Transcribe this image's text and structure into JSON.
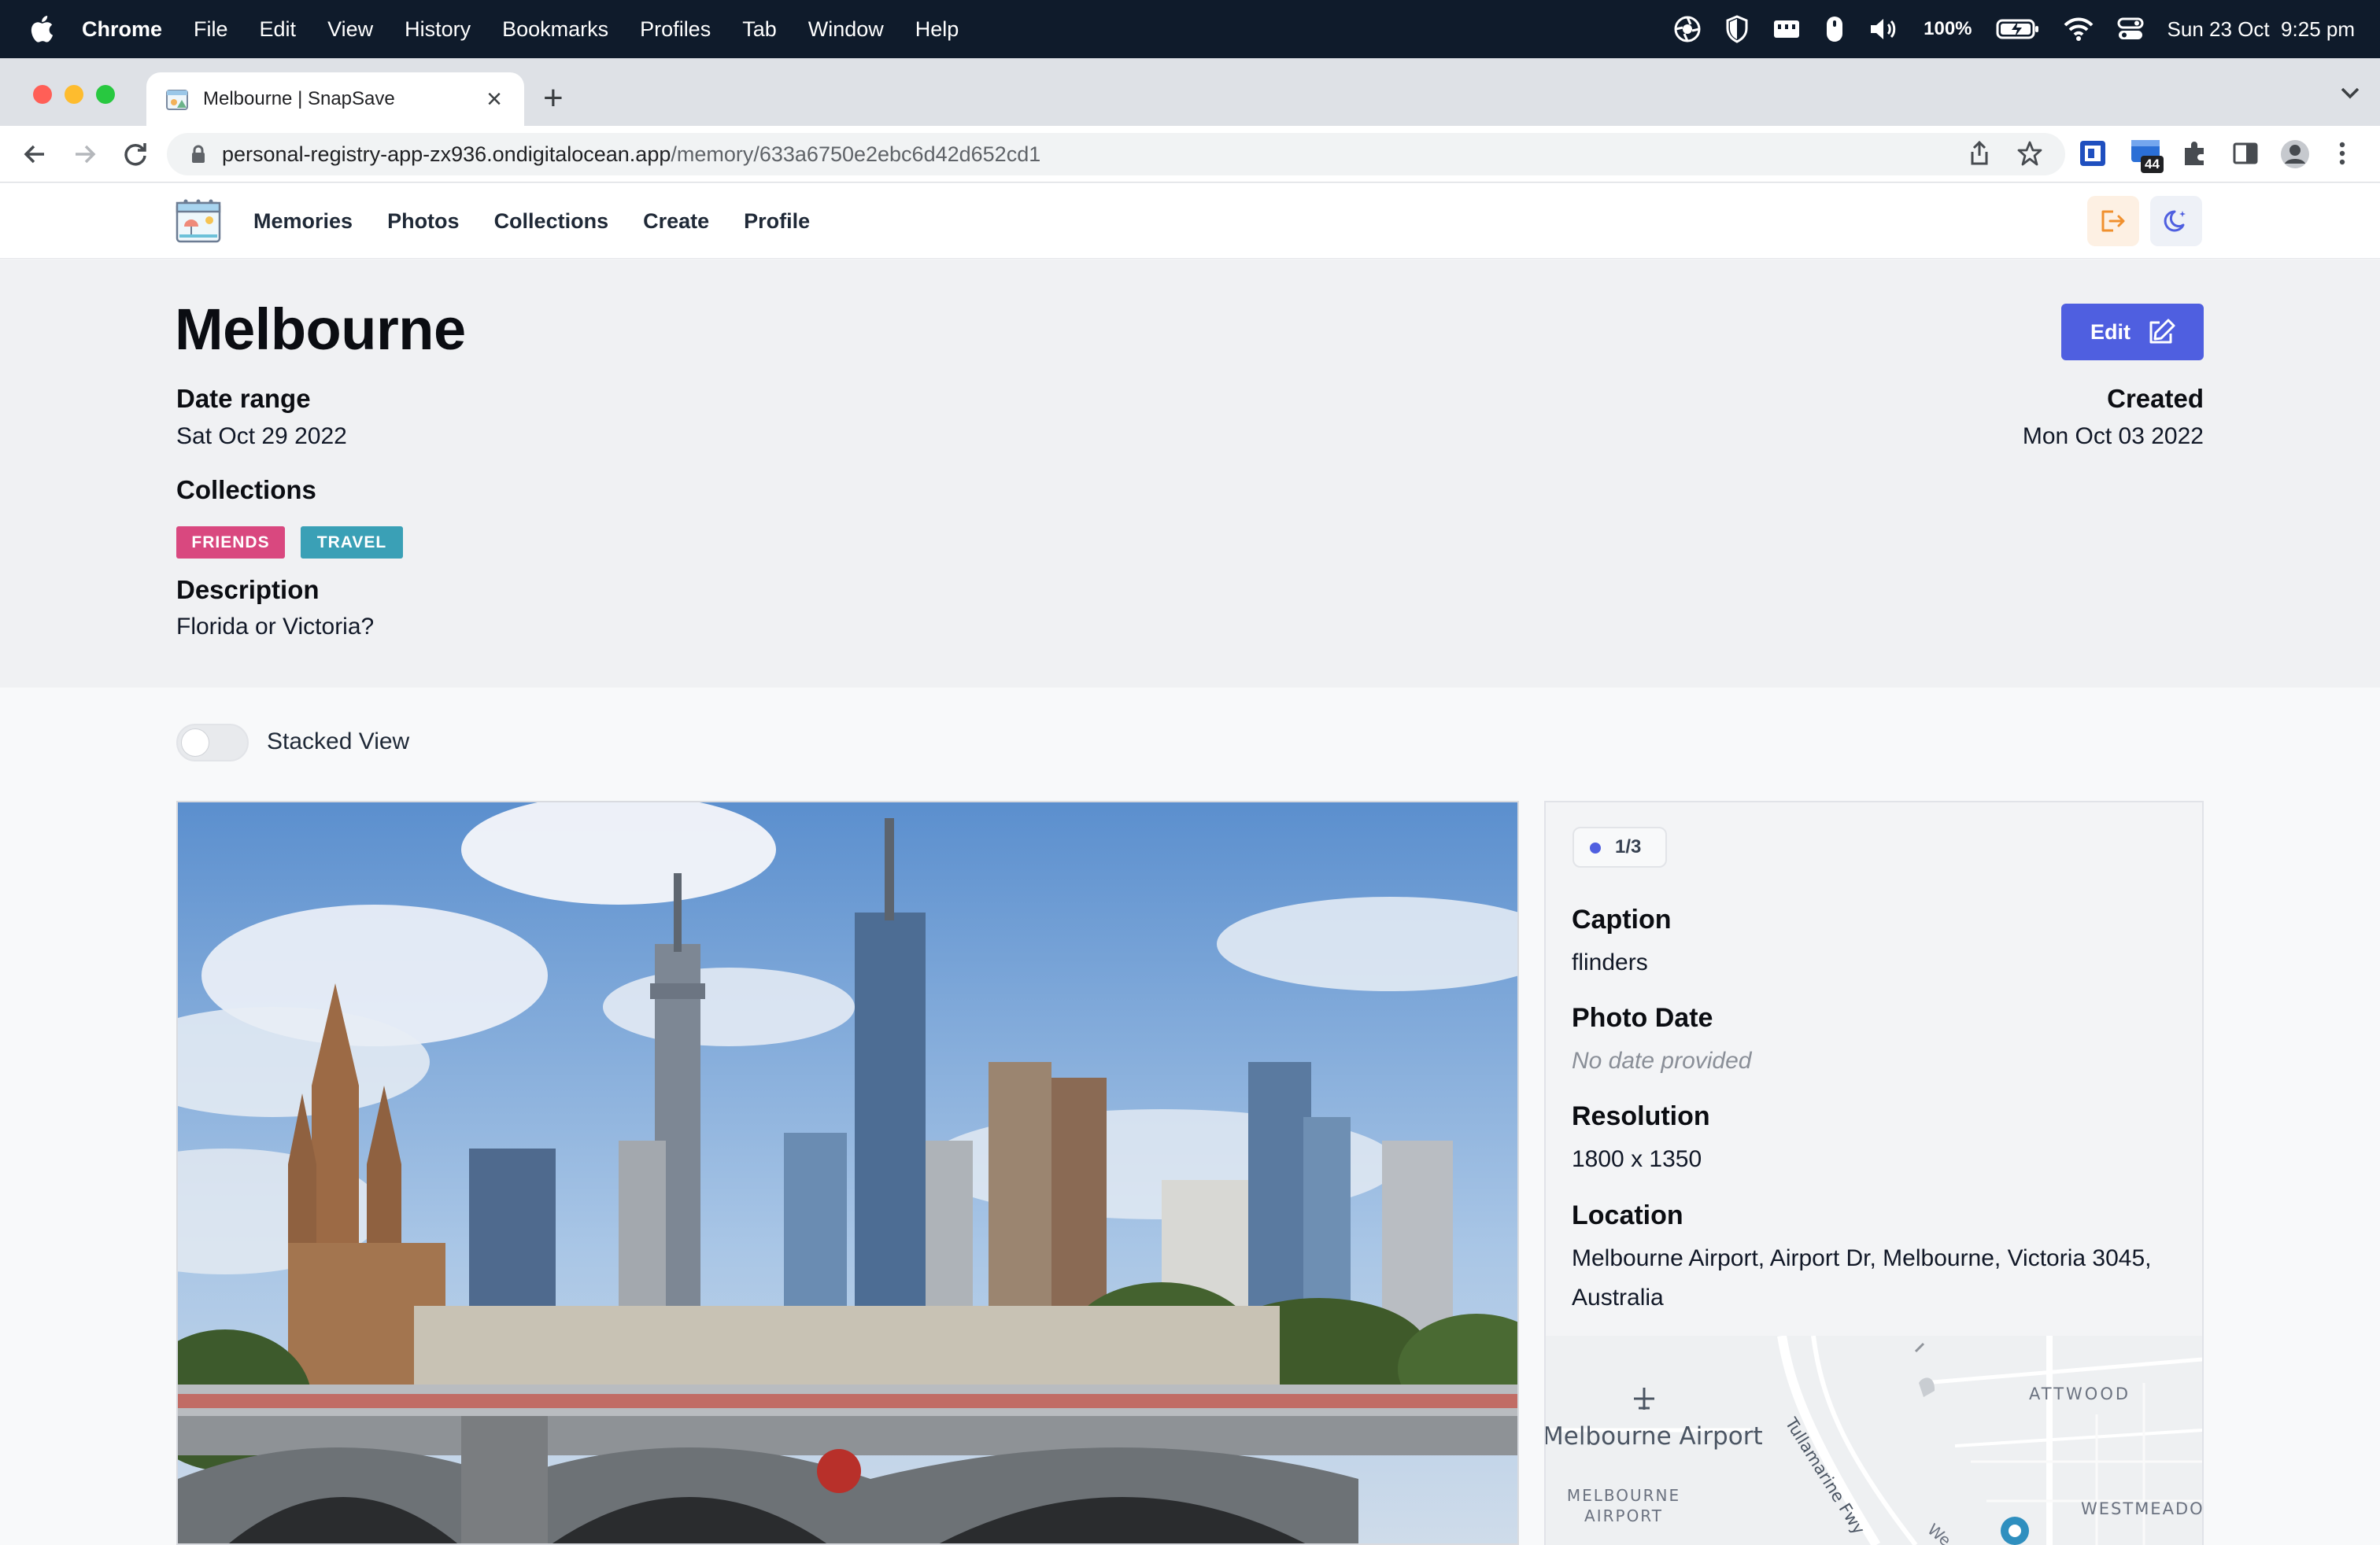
{
  "menubar": {
    "app_name": "Chrome",
    "items": [
      "File",
      "Edit",
      "View",
      "History",
      "Bookmarks",
      "Profiles",
      "Tab",
      "Window",
      "Help"
    ],
    "battery": "100%",
    "datetime": "Sun 23 Oct  9:25 pm"
  },
  "browser": {
    "tab_title": "Melbourne | SnapSave",
    "url_host": "personal-registry-app-zx936.ondigitalocean.app",
    "url_path": "/memory/633a6750e2ebc6d42d652cd1",
    "extension_badge": "44"
  },
  "app_nav": {
    "links": [
      "Memories",
      "Photos",
      "Collections",
      "Create",
      "Profile"
    ]
  },
  "memory": {
    "title": "Melbourne",
    "edit_label": "Edit",
    "date_range_label": "Date range",
    "date_range_value": "Sat Oct 29 2022",
    "created_label": "Created",
    "created_value": "Mon Oct 03 2022",
    "collections_label": "Collections",
    "collections": [
      {
        "name": "FRIENDS",
        "color": "#d9487f"
      },
      {
        "name": "TRAVEL",
        "color": "#3aa0b6"
      }
    ],
    "description_label": "Description",
    "description_value": "Florida or Victoria?"
  },
  "view_toggle": {
    "label": "Stacked View",
    "checked": false
  },
  "photo_info": {
    "counter": "1/3",
    "caption_label": "Caption",
    "caption_value": "flinders",
    "photo_date_label": "Photo Date",
    "photo_date_value": "No date provided",
    "resolution_label": "Resolution",
    "resolution_value": "1800 x 1350",
    "location_label": "Location",
    "location_value": "Melbourne Airport, Airport Dr, Melbourne, Victoria 3045, Australia"
  },
  "map": {
    "labels": {
      "airport_name": "Melbourne Airport",
      "airport_area": "MELBOURNE AIRPORT",
      "attwood": "ATTWOOD",
      "freeway": "Tullamarine Fwy",
      "westmeadows": "WESTMEADO",
      "road_fragment": "We"
    }
  },
  "colors": {
    "accent": "#4f5fe0",
    "menubar_bg": "#0f1b2b"
  }
}
